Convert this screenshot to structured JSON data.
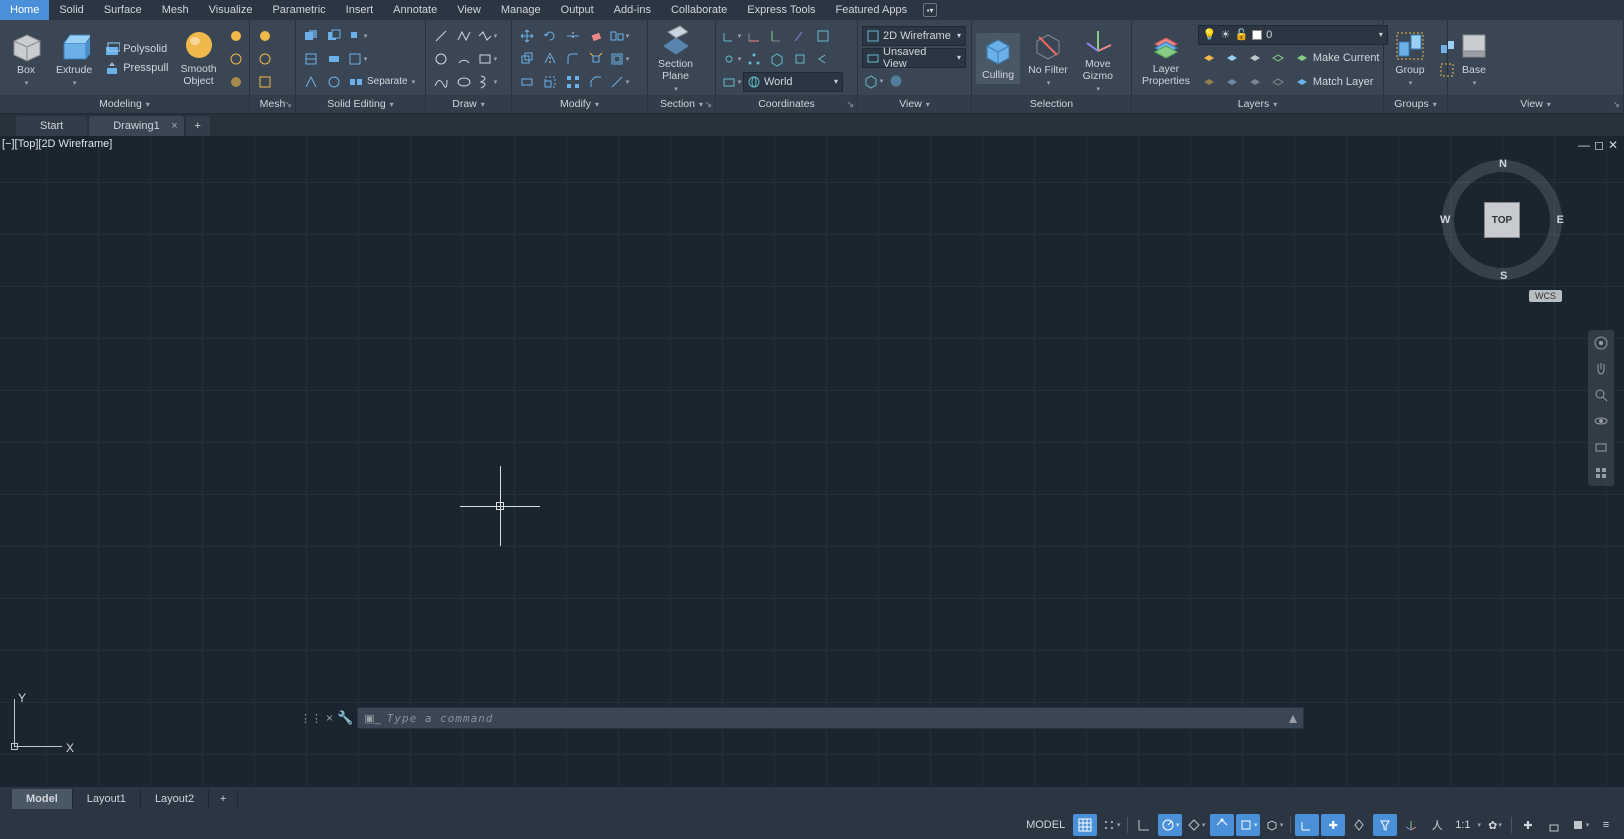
{
  "menu": {
    "items": [
      "Home",
      "Solid",
      "Surface",
      "Mesh",
      "Visualize",
      "Parametric",
      "Insert",
      "Annotate",
      "View",
      "Manage",
      "Output",
      "Add-ins",
      "Collaborate",
      "Express Tools",
      "Featured Apps"
    ],
    "active": 0
  },
  "ribbon": {
    "modeling": {
      "title": "Modeling",
      "box": "Box",
      "extrude": "Extrude",
      "polysolid": "Polysolid",
      "presspull": "Presspull",
      "smooth": "Smooth\nObject"
    },
    "mesh": {
      "title": "Mesh"
    },
    "solidediting": {
      "title": "Solid Editing",
      "separate": "Separate"
    },
    "draw": {
      "title": "Draw"
    },
    "modify": {
      "title": "Modify"
    },
    "section": {
      "title": "Section",
      "plane": "Section\nPlane"
    },
    "coordinates": {
      "title": "Coordinates",
      "world": "World"
    },
    "view": {
      "title": "View",
      "visualstyle": "2D Wireframe",
      "unsaved": "Unsaved View"
    },
    "selection": {
      "title": "Selection",
      "culling": "Culling",
      "nofilter": "No Filter",
      "movegizmo": "Move\nGizmo"
    },
    "layers": {
      "title": "Layers",
      "layerprops": "Layer\nProperties",
      "makecurrent": "Make Current",
      "matchlayer": "Match Layer",
      "current": "0"
    },
    "groups": {
      "title": "Groups",
      "group": "Group"
    },
    "viewpanel": {
      "title": "View",
      "base": "Base"
    }
  },
  "tabs": {
    "start": "Start",
    "drawing": "Drawing1"
  },
  "viewport": {
    "label": "[−][Top][2D Wireframe]",
    "cube_face": "TOP",
    "wcs": "WCS",
    "ucs_x": "X",
    "ucs_y": "Y",
    "compass": {
      "n": "N",
      "s": "S",
      "e": "E",
      "w": "W"
    }
  },
  "command": {
    "placeholder": "Type a command"
  },
  "layouts": {
    "items": [
      "Model",
      "Layout1",
      "Layout2"
    ],
    "active": 0
  },
  "status": {
    "model": "MODEL",
    "scale": "1:1"
  }
}
